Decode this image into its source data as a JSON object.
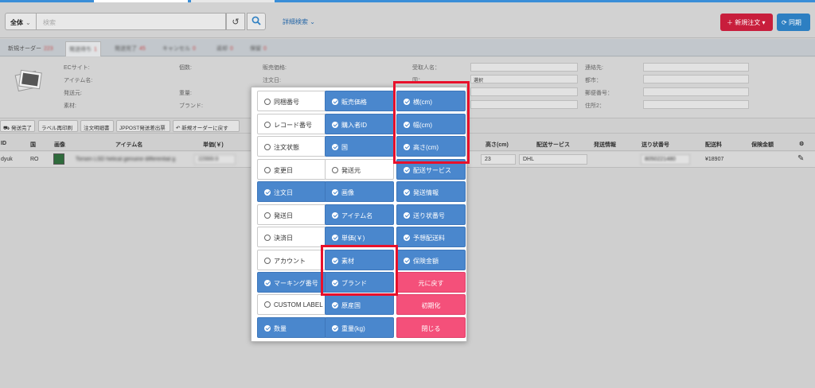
{
  "header": {
    "scope_label": "全体",
    "search_placeholder": "検索",
    "advanced_search": "詳細検索",
    "new_order_label": "新規注文",
    "sync_label": "同期"
  },
  "tabs": [
    {
      "label": "新規オーダー",
      "count": "223"
    },
    {
      "label": "発送待ち",
      "count": "1"
    },
    {
      "label": "発送完了",
      "count": "45"
    },
    {
      "label": "キャンセル",
      "count": "0"
    },
    {
      "label": "返却",
      "count": "0"
    },
    {
      "label": "保留",
      "count": "0"
    }
  ],
  "detail": {
    "ec_site": "ECサイト:",
    "item_name": "アイテム名:",
    "sender": "発送元:",
    "material": "素材:",
    "quantity": "個数:",
    "weight": "重量:",
    "brand": "ブランド:",
    "sale_price": "販売価格:",
    "order_date": "注文日:",
    "recipient": "受取人名：",
    "country": "国：",
    "country_value": "選択",
    "contact": "連絡先:",
    "city": "都市：",
    "postal": "郵便番号：",
    "address2": "住所2："
  },
  "toolbar": {
    "ship_done": "発送完了",
    "label_print": "ラベル再印刷",
    "order_print": "注文明細書",
    "jppost": "JPPOST発送差出票",
    "back_to_new": "新規オーダーに戻す"
  },
  "table": {
    "headers": {
      "id": "ID",
      "country": "国",
      "image": "画像",
      "item_name": "アイテム名",
      "unit_price": "単価(￥)",
      "height": "高さ(cm)",
      "ship_service": "配送サービス",
      "ship_info": "発送情報",
      "tracking": "送り状番号",
      "ship_fee": "配送料",
      "insurance": "保険金額"
    },
    "row": {
      "id": "dyuk",
      "country": "RO",
      "item_name": "Torsen LSD helical genuine differential g",
      "unit_price": "22999.9",
      "height": "23",
      "ship_service": "DHL",
      "tracking": "8050221480",
      "ship_fee": "¥18907"
    }
  },
  "column_picker": {
    "col1": [
      {
        "label": "同梱番号",
        "checked": false
      },
      {
        "label": "レコード番号",
        "checked": false
      },
      {
        "label": "注文状態",
        "checked": false
      },
      {
        "label": "変更日",
        "checked": false
      },
      {
        "label": "注文日",
        "checked": true
      },
      {
        "label": "発送日",
        "checked": false
      },
      {
        "label": "決済日",
        "checked": false
      },
      {
        "label": "アカウント",
        "checked": false
      },
      {
        "label": "マーキング番号",
        "checked": true
      },
      {
        "label": "CUSTOM LABEL",
        "checked": false
      },
      {
        "label": "数量",
        "checked": true
      }
    ],
    "col2": [
      {
        "label": "販売価格",
        "checked": true
      },
      {
        "label": "購入者ID",
        "checked": true
      },
      {
        "label": "国",
        "checked": true
      },
      {
        "label": "発送元",
        "checked": false
      },
      {
        "label": "画像",
        "checked": true
      },
      {
        "label": "アイテム名",
        "checked": true
      },
      {
        "label": "単価(￥)",
        "checked": true
      },
      {
        "label": "素材",
        "checked": true
      },
      {
        "label": "ブランド",
        "checked": true
      },
      {
        "label": "原産国",
        "checked": true
      },
      {
        "label": "重量(kg)",
        "checked": true
      }
    ],
    "col3": [
      {
        "label": "横(cm)",
        "checked": true
      },
      {
        "label": "幅(cm)",
        "checked": true
      },
      {
        "label": "高さ(cm)",
        "checked": true
      },
      {
        "label": "配送サービス",
        "checked": true
      },
      {
        "label": "発送情報",
        "checked": true
      },
      {
        "label": "送り状番号",
        "checked": true
      },
      {
        "label": "予想配送料",
        "checked": true
      },
      {
        "label": "保険金額",
        "checked": true
      }
    ],
    "actions": {
      "restore": "元に戻す",
      "reset": "初期化",
      "close": "閉じる"
    }
  },
  "colors": {
    "checked_bg": "#4a87cd",
    "action_pink": "#f4507a",
    "highlight_red": "#e8102b",
    "new_order_red": "#c81e3c",
    "sync_blue": "#2d7fc2"
  }
}
